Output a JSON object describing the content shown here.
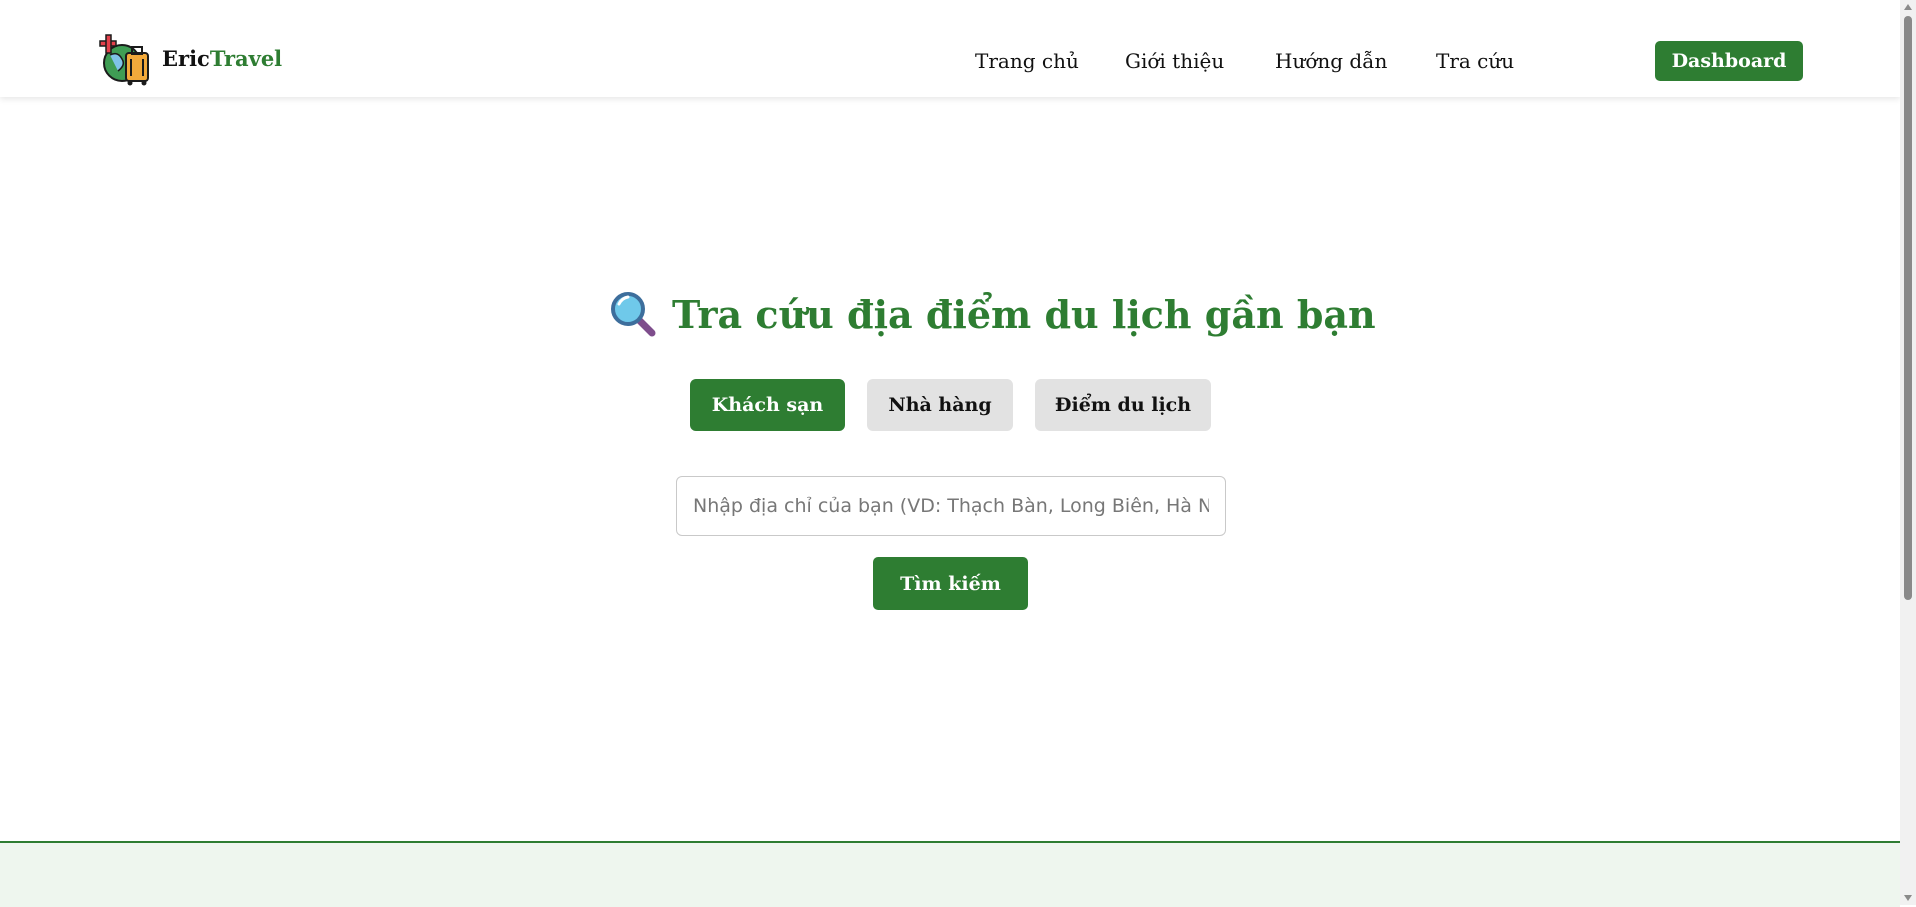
{
  "header": {
    "brand_part1": "Eric",
    "brand_part2": "Travel",
    "nav": [
      "Trang chủ",
      "Giới thiệu",
      "Hướng dẫn",
      "Tra cứu"
    ],
    "dashboard_label": "Dashboard"
  },
  "main": {
    "title": "Tra cứu địa điểm du lịch gần bạn",
    "title_icon": "magnifying-glass-icon",
    "tabs": [
      {
        "label": "Khách sạn",
        "active": true
      },
      {
        "label": "Nhà hàng",
        "active": false
      },
      {
        "label": "Điểm du lịch",
        "active": false
      }
    ],
    "search": {
      "placeholder": "Nhập địa chỉ của bạn (VD: Thạch Bàn, Long Biên, Hà Nội)",
      "value": "",
      "button_label": "Tìm kiếm"
    }
  },
  "colors": {
    "accent": "#2e7d32",
    "inactive_tab": "#e2e2e2",
    "footer_bg": "#eef6ee"
  }
}
